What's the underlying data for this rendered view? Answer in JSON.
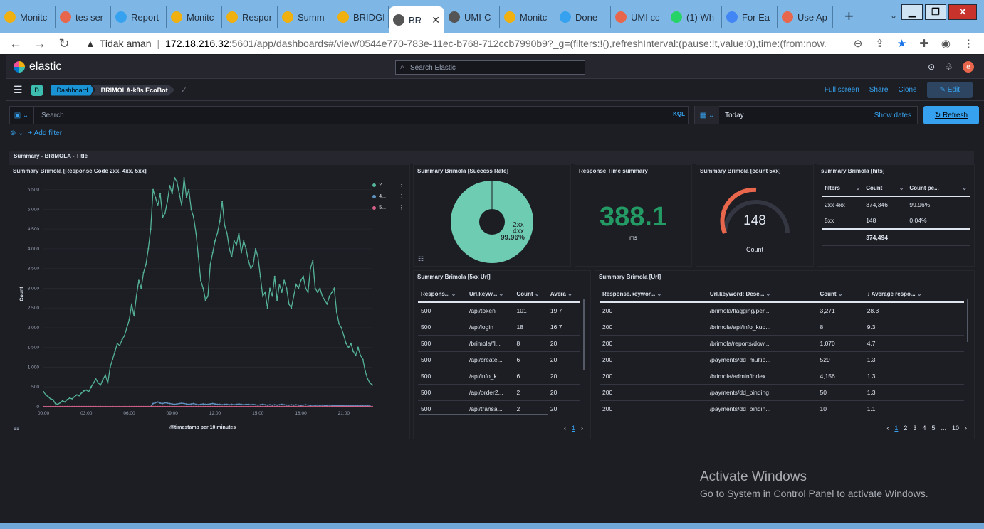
{
  "browser": {
    "tabs": [
      {
        "label": "Monitc",
        "color": "#f0b00f"
      },
      {
        "label": "tes ser",
        "color": "#e7664c"
      },
      {
        "label": "Report",
        "color": "#36a2ef"
      },
      {
        "label": "Monitc",
        "color": "#f0b00f"
      },
      {
        "label": "Respor",
        "color": "#f0b00f"
      },
      {
        "label": "Summ",
        "color": "#f0b00f"
      },
      {
        "label": "BRIDGI",
        "color": "#f0b00f"
      },
      {
        "label": "BR",
        "color": "#555555",
        "active": true
      },
      {
        "label": "UMI-C",
        "color": "#555555"
      },
      {
        "label": "Monitc",
        "color": "#f0b00f"
      },
      {
        "label": "Done",
        "color": "#36a2ef"
      },
      {
        "label": "UMI cc",
        "color": "#e7664c"
      },
      {
        "label": "(1) Wh",
        "color": "#25d366"
      },
      {
        "label": "For Ea",
        "color": "#4285f4"
      },
      {
        "label": "Use Ap",
        "color": "#e7664c"
      }
    ],
    "new_tab": "+",
    "security": "Tidak aman",
    "url_host": "172.18.216.32",
    "url_rest": ":5601/app/dashboards#/view/0544e770-783e-11ec-b768-712ccb7990b9?_g=(filters:!(),refreshInterval:(pause:!t,value:0),time:(from:now..."
  },
  "header": {
    "brand": "elastic",
    "search_placeholder": "Search Elastic",
    "avatar_letter": "e"
  },
  "crumbs": {
    "space": "D",
    "dashboard": "Dashboard",
    "current": "BRIMOLA-k8s EcoBot",
    "full_screen": "Full screen",
    "share": "Share",
    "clone": "Clone",
    "edit": "Edit"
  },
  "query": {
    "placeholder": "Search",
    "kql": "KQL",
    "date": "Today",
    "show_dates": "Show dates",
    "refresh": "Refresh",
    "add_filter": "+ Add filter"
  },
  "section_title": "Summary - BRIMOLA - Title",
  "panels": {
    "line_title": "Summary Brimola [Response Code 2xx, 4xx, 5xx]",
    "line_xlabel": "@timestamp per 10 minutes",
    "line_ylabel": "Count",
    "legend": [
      {
        "name": "2...",
        "color": "#54b399"
      },
      {
        "name": "4...",
        "color": "#6092c0"
      },
      {
        "name": "5...",
        "color": "#d36086"
      }
    ],
    "pie_title": "Summary Brimola [Success Rate]",
    "pie_label1": "2xx",
    "pie_label2": "4xx",
    "pie_pct": "99.96%",
    "rt_title": "Response Time summary",
    "rt_value": "388.1",
    "rt_unit": "ms",
    "g5_title": "Summary Brimola [count 5xx]",
    "g5_value": "148",
    "g5_label": "Count",
    "hits_title": "summary Brimola [hits]",
    "hits_headers": [
      "filters",
      "Count",
      "Count pe..."
    ],
    "hits_rows": [
      [
        "2xx 4xx",
        "374,346",
        "99.96%"
      ],
      [
        "5xx",
        "148",
        "0.04%"
      ]
    ],
    "hits_total": "374,494",
    "t5_title": "Summary Brimola [5xx Url]",
    "t5_headers": [
      "Respons...",
      "Url.keyw...",
      "Count",
      "Avera"
    ],
    "t5_rows": [
      [
        "500",
        "/api/token",
        "101",
        "19.7"
      ],
      [
        "500",
        "/api/login",
        "18",
        "16.7"
      ],
      [
        "500",
        "/brimola/fl...",
        "8",
        "20"
      ],
      [
        "500",
        "/api/create...",
        "6",
        "20"
      ],
      [
        "500",
        "/api/info_k...",
        "6",
        "20"
      ],
      [
        "500",
        "/api/order2...",
        "2",
        "20"
      ],
      [
        "500",
        "/api/transa...",
        "2",
        "20"
      ]
    ],
    "t5_page": "1",
    "turl_title": "Summary Brimola [Url]",
    "turl_headers": [
      "Response.keywor...",
      "Url.keyword: Desc...",
      "Count",
      "↓ Average respo..."
    ],
    "turl_rows": [
      [
        "200",
        "/brimola/flagging/per...",
        "3,271",
        "28.3"
      ],
      [
        "200",
        "/brimola/api/info_kuo...",
        "8",
        "9.3"
      ],
      [
        "200",
        "/brimola/reports/dow...",
        "1,070",
        "4.7"
      ],
      [
        "200",
        "/payments/dd_multip...",
        "529",
        "1.3"
      ],
      [
        "200",
        "/brimola/admin/index",
        "4,156",
        "1.3"
      ],
      [
        "200",
        "/payments/dd_binding",
        "50",
        "1.3"
      ],
      [
        "200",
        "/payments/dd_bindin...",
        "10",
        "1.1"
      ]
    ],
    "turl_pages": [
      "1",
      "2",
      "3",
      "4",
      "5",
      "...",
      "10"
    ]
  },
  "chart_data": {
    "type": "line",
    "xticks": [
      "00:00",
      "03:00",
      "06:00",
      "09:00",
      "12:00",
      "15:00",
      "18:00",
      "21:00"
    ],
    "yticks": [
      "0",
      "500",
      "1,000",
      "1,500",
      "2,000",
      "2,500",
      "3,000",
      "3,500",
      "4,000",
      "4,500",
      "5,000",
      "5,500"
    ],
    "ylim": [
      0,
      5800
    ],
    "xlim": [
      0,
      138
    ],
    "series": [
      {
        "name": "2...",
        "color": "#54b399",
        "values": [
          380,
          300,
          250,
          200,
          180,
          80,
          60,
          100,
          150,
          120,
          180,
          220,
          200,
          250,
          300,
          280,
          350,
          400,
          420,
          380,
          500,
          600,
          700,
          600,
          550,
          700,
          800,
          600,
          1000,
          1200,
          1400,
          1600,
          1550,
          1700,
          1800,
          2000,
          2200,
          2600,
          2300,
          2800,
          3200,
          3000,
          3400,
          3600,
          4000,
          4500,
          5500,
          5300,
          5100,
          5400,
          4800,
          4900,
          5200,
          5600,
          5400,
          5800,
          5700,
          5400,
          5100,
          5800,
          5300,
          5500,
          5000,
          4800,
          4400,
          3800,
          3200,
          3000,
          2700,
          2800,
          3600,
          3900,
          4200,
          4400,
          4700,
          5200,
          4600,
          4400,
          4000,
          3800,
          4200,
          4100,
          4400,
          3900,
          4200,
          4000,
          3700,
          3500,
          3600,
          4000,
          3800,
          3300,
          2800,
          2900,
          2500,
          3000,
          2800,
          3300,
          2700,
          3100,
          2900,
          3200,
          3000,
          2600,
          2500,
          2800,
          3100,
          3000,
          3200,
          3300,
          3000,
          2900,
          3500,
          3700,
          3000,
          2900,
          3000,
          2800,
          2700,
          2600,
          2800,
          2900,
          3000,
          2400,
          2100,
          2000,
          1800,
          1600,
          1500,
          1600,
          1400,
          1300,
          1500,
          1300,
          1200,
          900,
          700,
          600,
          550
        ]
      },
      {
        "name": "4...",
        "color": "#6092c0",
        "values": [
          0,
          0,
          0,
          0,
          0,
          0,
          0,
          0,
          0,
          0,
          0,
          0,
          0,
          0,
          0,
          0,
          0,
          0,
          0,
          0,
          0,
          0,
          0,
          0,
          0,
          0,
          0,
          0,
          0,
          0,
          0,
          0,
          0,
          0,
          0,
          0,
          0,
          0,
          0,
          0,
          0,
          0,
          0,
          0,
          0,
          0,
          80,
          100,
          120,
          90,
          80,
          100,
          90,
          80,
          70,
          60,
          70,
          80,
          90,
          80,
          70,
          60,
          70,
          80,
          60,
          50,
          60,
          70,
          60,
          60,
          70,
          80,
          70,
          60,
          60,
          50,
          60,
          60,
          50,
          60,
          50,
          60,
          70,
          60,
          50,
          60,
          60,
          50,
          60,
          50,
          40,
          50,
          60,
          50,
          40,
          50,
          40,
          50,
          40,
          50,
          60,
          50,
          40,
          40,
          50,
          40,
          50,
          40,
          30,
          40,
          50,
          40,
          30,
          40,
          30,
          40,
          30,
          40,
          30,
          30,
          40,
          30,
          30,
          30,
          20,
          30,
          20,
          20,
          20,
          20,
          20,
          20,
          20,
          20,
          20,
          20,
          20,
          20
        ]
      },
      {
        "name": "5...",
        "color": "#d36086",
        "values": [
          5,
          5,
          5,
          5,
          5,
          5,
          5,
          5,
          5,
          5,
          5,
          5,
          5,
          5,
          5,
          5,
          5,
          5,
          5,
          5,
          5,
          5,
          5,
          5,
          5,
          5,
          5,
          5,
          5,
          5,
          5,
          5,
          5,
          5,
          5,
          5,
          5,
          5,
          5,
          5,
          5,
          5,
          5,
          5,
          5,
          5,
          5,
          5,
          5,
          5,
          5,
          5,
          5,
          5,
          5,
          5,
          5,
          5,
          5,
          5,
          5,
          5,
          5,
          5,
          5,
          5,
          5,
          5,
          5,
          5,
          5,
          5,
          5,
          5,
          5,
          5,
          5,
          5,
          5,
          5,
          5,
          5,
          5,
          5,
          5,
          5,
          5,
          5,
          5,
          5,
          5,
          5,
          5,
          5,
          5,
          5,
          5,
          5,
          5,
          5,
          5,
          5,
          5,
          5,
          5,
          5,
          5,
          5,
          5,
          5,
          5,
          5,
          5,
          5,
          5,
          5,
          5,
          5,
          5,
          5,
          5,
          5,
          5,
          5,
          5,
          5,
          5,
          5,
          5,
          5,
          5,
          5,
          5,
          5,
          5,
          5,
          5,
          5,
          5
        ]
      }
    ]
  },
  "os": {
    "activate_title": "Activate Windows",
    "activate_sub": "Go to System in Control Panel to activate Windows."
  }
}
